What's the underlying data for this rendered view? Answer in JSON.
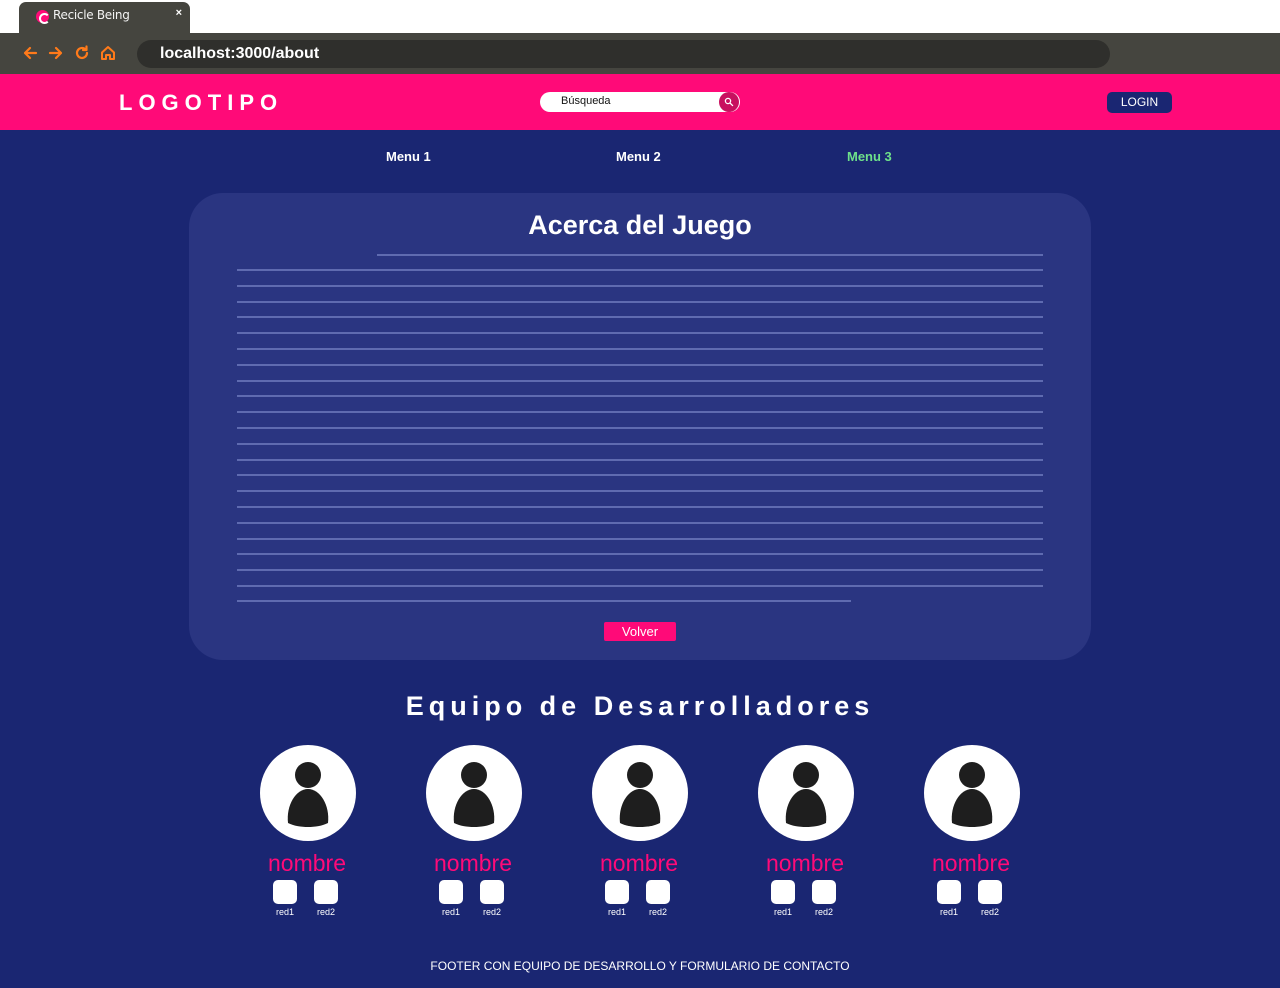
{
  "browser": {
    "tab_title": "Recicle Being",
    "tab_close": "×",
    "url": "localhost:3000/about"
  },
  "header": {
    "logo": "LOGOTIPO",
    "search_placeholder": "Búsqueda",
    "login_label": "LOGIN"
  },
  "menu": {
    "items": [
      {
        "label": "Menu 1",
        "active": false
      },
      {
        "label": "Menu 2",
        "active": false
      },
      {
        "label": "Menu 3",
        "active": true
      }
    ]
  },
  "about": {
    "title": "Acerca del Juego",
    "back_label": "Volver"
  },
  "team": {
    "title": "Equipo de Desarrolladores",
    "members": [
      {
        "name": "nombre",
        "social1": "red1",
        "social2": "red2"
      },
      {
        "name": "nombre",
        "social1": "red1",
        "social2": "red2"
      },
      {
        "name": "nombre",
        "social1": "red1",
        "social2": "red2"
      },
      {
        "name": "nombre",
        "social1": "red1",
        "social2": "red2"
      },
      {
        "name": "nombre",
        "social1": "red1",
        "social2": "red2"
      }
    ]
  },
  "footer": {
    "text": "FOOTER CON EQUIPO DE DESARROLLO Y FORMULARIO DE CONTACTO"
  },
  "colors": {
    "brand_pink": "#ff0a78",
    "page_background": "#1a2672",
    "card_background": "#2a3581",
    "active_menu": "#6ee08a",
    "browser_chrome": "#45453f",
    "nav_icons": "#ff7a1a"
  }
}
